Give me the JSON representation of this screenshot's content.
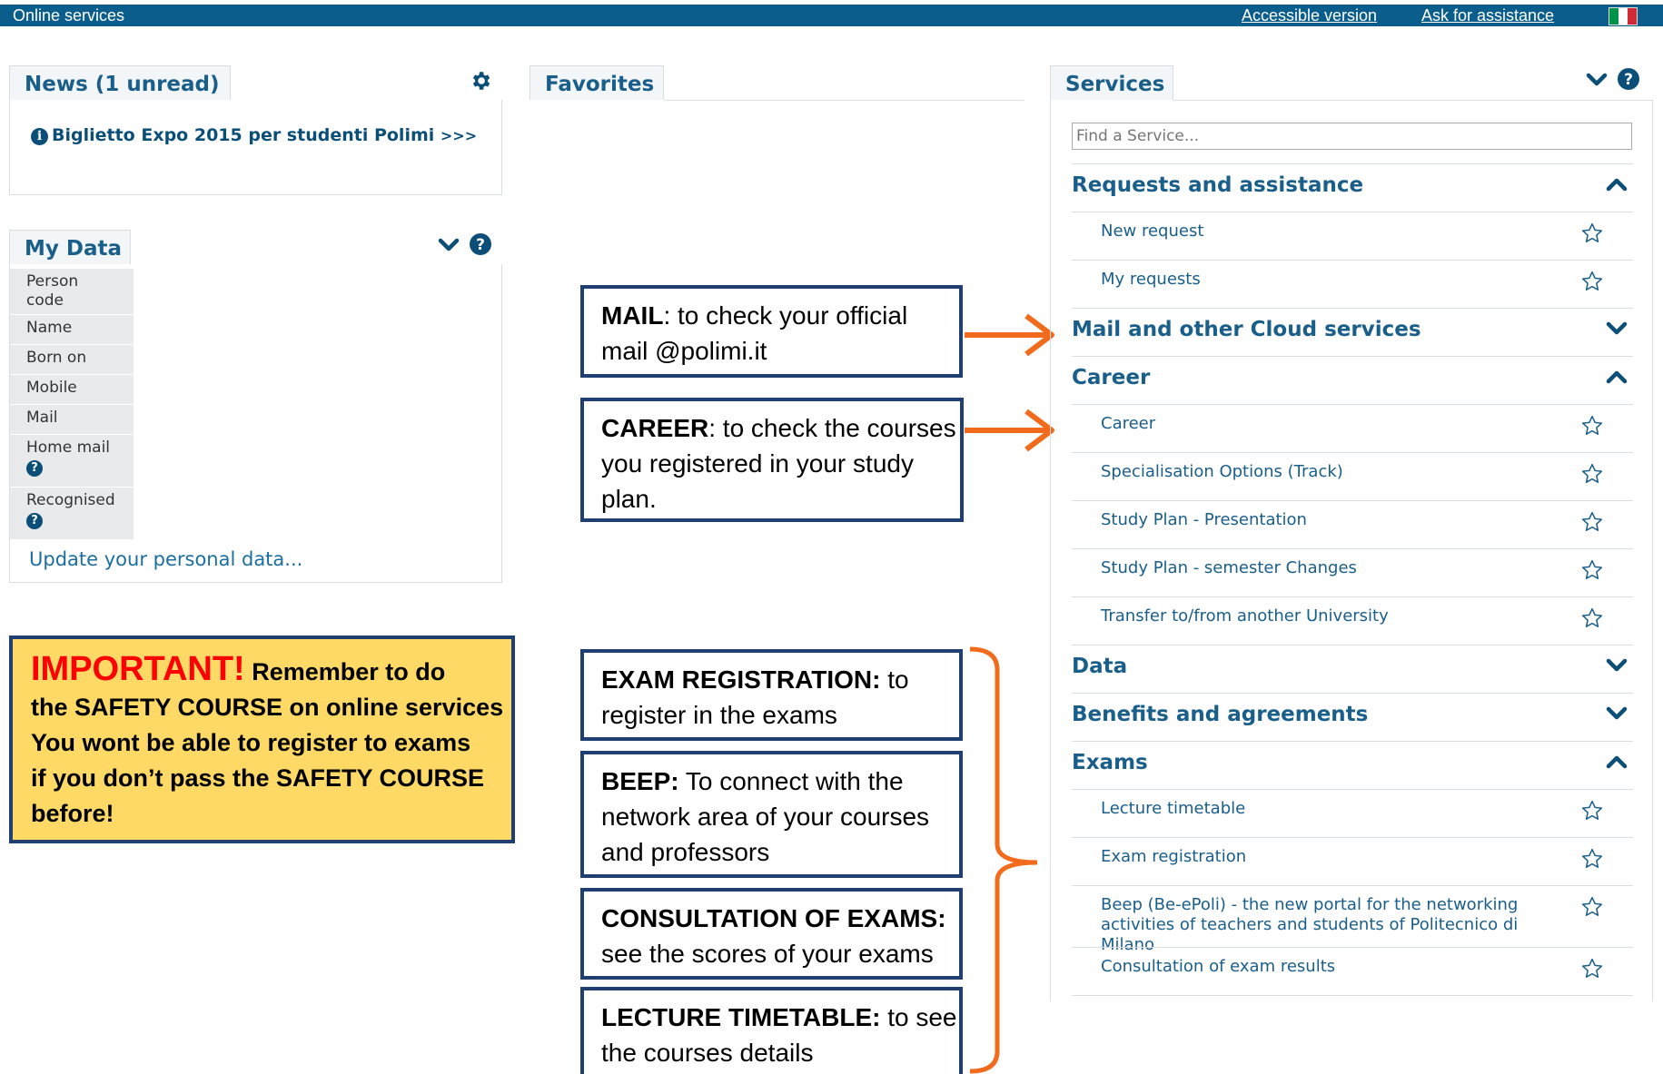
{
  "topbar": {
    "title": "Online services",
    "accessible_link": "Accessible version",
    "assistance_link": "Ask for assistance"
  },
  "news": {
    "tab_label": "News (1 unread)",
    "item_text": "Biglietto Expo 2015 per studenti Polimi",
    "item_more": ">>>"
  },
  "favorites": {
    "tab_label": "Favorites"
  },
  "my_data": {
    "tab_label": "My Data",
    "rows": [
      {
        "label": "Person code"
      },
      {
        "label": "Name"
      },
      {
        "label": "Born on"
      },
      {
        "label": "Mobile"
      },
      {
        "label": "Mail"
      },
      {
        "label": "Home mail"
      },
      {
        "label": "Recognised"
      }
    ],
    "update_link": "Update your personal data..."
  },
  "important": {
    "heading": "IMPORTANT!",
    "line1": "Remember to do",
    "line2": "the SAFETY COURSE on online services",
    "line3": "You wont be able to register to exams",
    "line4": "if you don’t pass the SAFETY COURSE",
    "line5": "before!"
  },
  "callouts": {
    "mail": {
      "title": "MAIL",
      "text": ": to check  your official mail @polimi.it"
    },
    "career": {
      "title": "CAREER",
      "text": ": to check  the courses you registered in your study plan."
    },
    "exam_registration": {
      "title": "EXAM REGISTRATION:",
      "text": " to register in the exams"
    },
    "beep": {
      "title": "BEEP:",
      "text": " To connect with the network area of your courses and professors"
    },
    "consultation": {
      "title": "CONSULTATION OF EXAMS:",
      "text": " see the scores of your exams"
    },
    "timetable": {
      "title": "LECTURE TIMETABLE:",
      "text": " to see the courses details"
    }
  },
  "services": {
    "tab_label": "Services",
    "search_placeholder": "Find a Service...",
    "categories": [
      {
        "label": "Requests and assistance",
        "expanded": true,
        "items": [
          "New request",
          "My requests"
        ]
      },
      {
        "label": "Mail and other Cloud services",
        "expanded": false,
        "items": []
      },
      {
        "label": "Career",
        "expanded": true,
        "items": [
          "Career",
          "Specialisation Options (Track)",
          "Study Plan - Presentation",
          "Study Plan - semester Changes",
          "Transfer to/from another University"
        ]
      },
      {
        "label": "Data",
        "expanded": false,
        "items": []
      },
      {
        "label": "Benefits and agreements",
        "expanded": false,
        "items": []
      },
      {
        "label": "Exams",
        "expanded": true,
        "items": [
          "Lecture timetable",
          "Exam registration",
          "Beep (Be-ePoli) - the new portal for the networking activities of teachers and students of Politecnico di Milano",
          "Consultation of exam results"
        ]
      }
    ]
  },
  "colors": {
    "topbar": "#0b5e8c",
    "link_blue": "#1a5e8a",
    "callout_border": "#1f3f73",
    "arrow_orange": "#f26b1d",
    "important_bg": "#ffd966",
    "important_red": "#ff0000",
    "flag": [
      "#009246",
      "#ffffff",
      "#ce2b37"
    ]
  },
  "icons": {
    "news_settings": "gear-icon",
    "collapse": "chevron-down-icon",
    "expand": "chevron-up-icon",
    "help": "help-icon",
    "favorite": "star-icon",
    "info": "info-icon"
  }
}
